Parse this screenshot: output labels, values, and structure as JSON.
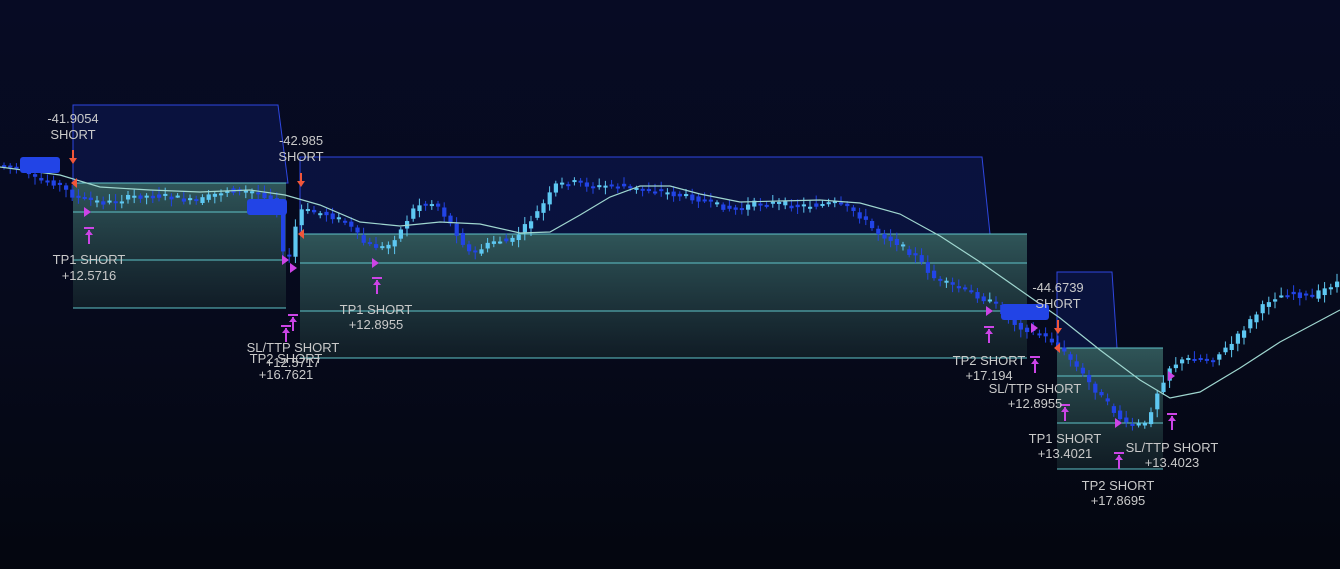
{
  "chart_data": {
    "type": "candlestick",
    "title": "",
    "xlabel": "",
    "ylabel": "",
    "grid": false,
    "colors": {
      "bull": "#5ec8f2",
      "bear": "#2244e6",
      "ma_line": "#9fd6cf",
      "stop_zone_fill": "#0c1a57",
      "stop_zone_line": "#2e46e0",
      "target_zone_fill": "#3d6e6c",
      "level_line": "#5fc3c8",
      "entry_arrow": "#f0563a",
      "tp_marker": "#cc44e6",
      "entry_tag": "#2244e6"
    },
    "trades": [
      {
        "direction": "SHORT",
        "entry": {
          "value": "-41.9054",
          "label": "SHORT"
        },
        "exits": [
          {
            "label": "TP1 SHORT",
            "value": "+12.5716"
          },
          {
            "label": "TP2 SHORT",
            "value": "+12.5717"
          },
          {
            "label": "SL/TTP SHORT",
            "value": "+16.7621"
          }
        ]
      },
      {
        "direction": "SHORT",
        "entry": {
          "value": "-42.985",
          "label": "SHORT"
        },
        "exits": [
          {
            "label": "TP1 SHORT",
            "value": "+12.8955"
          },
          {
            "label": "TP2 SHORT",
            "value": "+17.194"
          },
          {
            "label": "SL/TTP SHORT",
            "value": "+12.8955"
          }
        ]
      },
      {
        "direction": "SHORT",
        "entry": {
          "value": "-44.6739",
          "label": "SHORT"
        },
        "exits": [
          {
            "label": "TP1 SHORT",
            "value": "+13.4021"
          },
          {
            "label": "SL/TTP SHORT",
            "value": "+13.4023"
          },
          {
            "label": "TP2 SHORT",
            "value": "+17.8695"
          }
        ]
      }
    ]
  }
}
